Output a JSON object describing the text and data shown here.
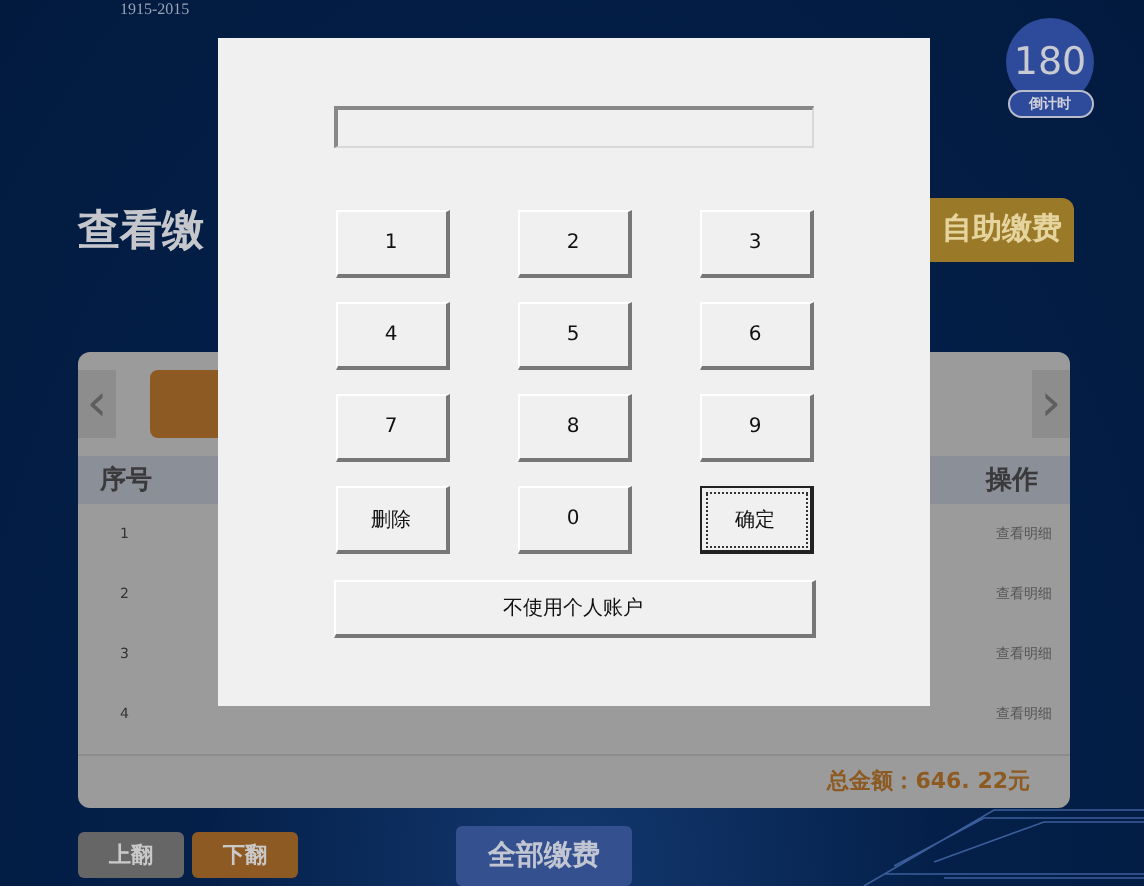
{
  "header": {
    "years": "1915-2015",
    "timer": {
      "value": "180",
      "label": "倒计时"
    }
  },
  "page_title": "查看缴",
  "self_pay_button": "自助缴费",
  "panel": {
    "prev_arrow": "‹",
    "next_arrow": "›",
    "columns": [
      {
        "label": "序号"
      },
      {
        "label": "操作"
      }
    ],
    "rows": [
      {
        "index": "1",
        "action": "查看明细"
      },
      {
        "index": "2",
        "action": "查看明细"
      },
      {
        "index": "3",
        "action": "查看明细"
      },
      {
        "index": "4",
        "action": "查看明细"
      }
    ],
    "total": "总金额：646. 22元"
  },
  "pager": [
    {
      "label": "上翻",
      "enabled": false
    },
    {
      "label": "下翻",
      "enabled": true
    }
  ],
  "pay_all_button": "全部缴费",
  "keypad": {
    "keys": [
      {
        "label": "1",
        "focused": false
      },
      {
        "label": "2",
        "focused": false
      },
      {
        "label": "3",
        "focused": false
      },
      {
        "label": "4",
        "focused": false
      },
      {
        "label": "5",
        "focused": false
      },
      {
        "label": "6",
        "focused": false
      },
      {
        "label": "7",
        "focused": false
      },
      {
        "label": "8",
        "focused": false
      },
      {
        "label": "9",
        "focused": false
      },
      {
        "label": "删除",
        "focused": false
      },
      {
        "label": "0",
        "focused": false
      },
      {
        "label": "确定",
        "focused": true
      }
    ],
    "wide_button": "不使用个人账户"
  }
}
